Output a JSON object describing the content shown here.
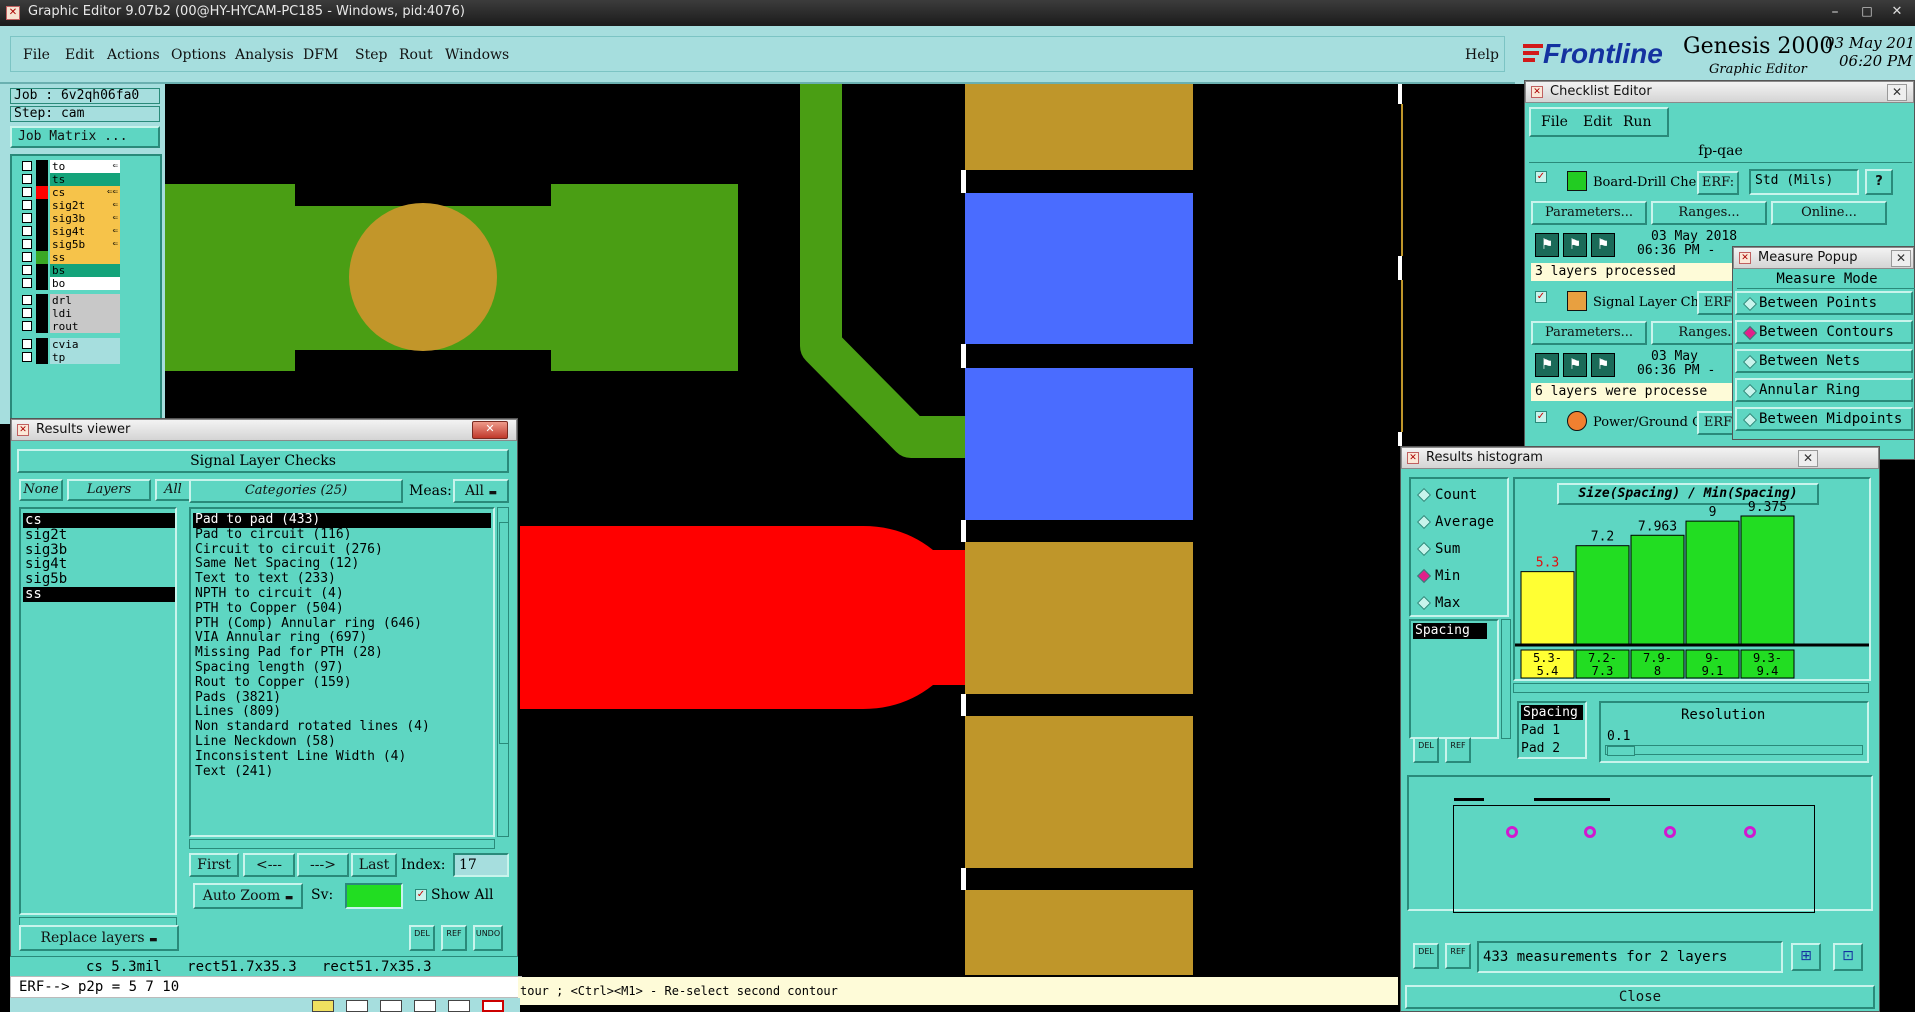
{
  "titlebar": {
    "text": "Graphic Editor 9.07b2 (00@HY-HYCAM-PC185 - Windows, pid:4076)"
  },
  "menu": {
    "items": [
      "File",
      "Edit",
      "Actions",
      "Options",
      "Analysis",
      "DFM",
      "Step",
      "Rout",
      "Windows"
    ],
    "help": "Help"
  },
  "brand": {
    "logo": "Frontline",
    "product": "Genesis 2000",
    "subtitle": "Graphic Editor",
    "date": "03 May 201",
    "time": "06:20 PM"
  },
  "job": {
    "job": "Job : 6v2qh06fa0",
    "step": "Step: cam",
    "matrix_button": "Job Matrix ..."
  },
  "layers": [
    {
      "name": "to",
      "color": "#ffffff",
      "swatch": "#000000",
      "marker": "⇐"
    },
    {
      "name": "ts",
      "color": "#14a37a",
      "swatch": "#000000",
      "marker": ""
    },
    {
      "name": "cs",
      "color": "#f6c34a",
      "swatch": "#ff0000",
      "marker": "⇐⇐"
    },
    {
      "name": "sig2t",
      "color": "#f6c34a",
      "swatch": "#000000",
      "marker": "⇐"
    },
    {
      "name": "sig3b",
      "color": "#f6c34a",
      "swatch": "#000000",
      "marker": "⇐"
    },
    {
      "name": "sig4t",
      "color": "#f6c34a",
      "swatch": "#000000",
      "marker": "⇐"
    },
    {
      "name": "sig5b",
      "color": "#f6c34a",
      "swatch": "#000000",
      "marker": "⇐"
    },
    {
      "name": "ss",
      "color": "#f6c34a",
      "swatch": "#3aa824",
      "marker": ""
    },
    {
      "name": "bs",
      "color": "#14a37a",
      "swatch": "#000000",
      "marker": ""
    },
    {
      "name": "bo",
      "color": "#ffffff",
      "swatch": "#000000",
      "marker": ""
    },
    {
      "name": "drl",
      "color": "#c8c8c8",
      "swatch": "#000000",
      "marker": ""
    },
    {
      "name": "ldi",
      "color": "#c8c8c8",
      "swatch": "#000000",
      "marker": ""
    },
    {
      "name": "rout",
      "color": "#c8c8c8",
      "swatch": "#000000",
      "marker": ""
    },
    {
      "name": "cvia",
      "color": "#a6dede",
      "swatch": "#000000",
      "marker": ""
    },
    {
      "name": "tp",
      "color": "#a6dede",
      "swatch": "#000000",
      "marker": ""
    }
  ],
  "results_viewer": {
    "title": "Results viewer",
    "heading": "Signal Layer Checks",
    "none": "None",
    "layers_label": "Layers",
    "all": "All",
    "categories_label": "Categories (25)",
    "meas_label": "Meas:",
    "meas_value": "All",
    "layer_list": [
      "cs",
      "sig2t",
      "sig3b",
      "sig4t",
      "sig5b",
      "ss"
    ],
    "categories": [
      "Pad to pad (433)",
      "Pad to circuit (116)",
      "Circuit to circuit (276)",
      "Same Net Spacing (12)",
      "Text to text (233)",
      "NPTH to circuit (4)",
      "PTH to Copper (504)",
      "PTH (Comp) Annular ring (646)",
      "VIA Annular ring (697)",
      "Missing Pad for PTH (28)",
      "Spacing length (97)",
      "Rout to Copper (159)",
      "Pads (3821)",
      "Lines (809)",
      "Non standard rotated lines (4)",
      "Line Neckdown (58)",
      "Inconsistent Line Width (4)",
      "Text (241)"
    ],
    "first": "First",
    "prev": "<---",
    "next": "--->",
    "last": "Last",
    "index_label": "Index:",
    "index_value": "17",
    "auto_zoom": "Auto Zoom",
    "sv_label": "Sv:",
    "show_all": "Show All",
    "replace_layers": "Replace layers"
  },
  "status": {
    "line1": "cs 5.3mil   rect51.7x35.3   rect51.7x35.3",
    "line2": "ERF--> p2p = 5 7 10",
    "prompt": "tour ; <Ctrl><M1> - Re-select second contour"
  },
  "checklist": {
    "title": "Checklist Editor",
    "menu": [
      "File",
      "Edit",
      "Run"
    ],
    "name": "fp-qae",
    "checks": [
      {
        "label": "Board-Drill Che",
        "erf": "ERF:",
        "erf_value": "Std (Mils)",
        "date": "03 May 2018",
        "time": "06:36 PM -",
        "status": "3 layers processed"
      },
      {
        "label": "Signal Layer Ch",
        "erf": "ERF",
        "date": "03 May",
        "time": "06:36 PM -",
        "status": "6 layers were processe"
      },
      {
        "label": "Power/Ground C",
        "erf": "ERF"
      }
    ],
    "params": "Parameters...",
    "ranges": "Ranges...",
    "online": "Online...",
    "help_icon": "?"
  },
  "measure": {
    "title": "Measure Popup",
    "heading": "Measure Mode",
    "options": [
      "Between Points",
      "Between Contours",
      "Between Nets",
      "Annular Ring",
      "Between Midpoints"
    ],
    "selected": 1
  },
  "histogram": {
    "title": "Results histogram",
    "modes": [
      "Count",
      "Average",
      "Sum",
      "Min",
      "Max"
    ],
    "selected_mode": 3,
    "field": "Spacing",
    "chart_title": "Size(Spacing) / Min(Spacing)",
    "bars": [
      {
        "label": "5.3",
        "value": 5.3,
        "range": "5.3-\n5.4",
        "color": "#ffff33"
      },
      {
        "label": "7.2",
        "value": 7.2,
        "range": "7.2-\n7.3",
        "color": "#22dd22"
      },
      {
        "label": "7.963",
        "value": 7.963,
        "range": "7.9-\n8",
        "color": "#22dd22"
      },
      {
        "label": "9",
        "value": 9,
        "range": "9-\n9.1",
        "color": "#22dd22"
      },
      {
        "label": "9.375",
        "value": 9.375,
        "range": "9.3-\n9.4",
        "color": "#22dd22"
      }
    ],
    "attributes": [
      "Spacing",
      "Pad 1",
      "Pad 2"
    ],
    "resolution_label": "Resolution",
    "resolution_value": "0.1",
    "summary": "433 measurements for 2 layers",
    "close": "Close",
    "del": "DEL",
    "ref": "REF",
    "undo": "UNDO"
  }
}
